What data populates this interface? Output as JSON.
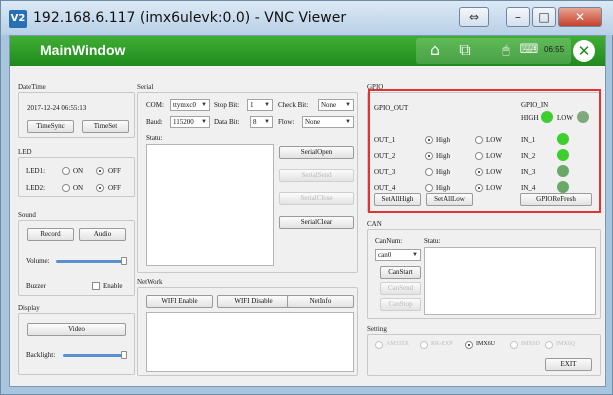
{
  "window": {
    "title": "192.168.6.117 (imx6ulevk:0.0) - VNC Viewer",
    "app_icon": "V2",
    "buttons": {
      "restore": "⇔",
      "minimize": "–",
      "maximize": "□",
      "close": "✕"
    }
  },
  "header": {
    "title": "MainWindow",
    "time": "06:55",
    "icons": [
      "home-icon",
      "window-switch-icon",
      "mouse-icon",
      "keyboard-icon"
    ],
    "close_glyph": "✕",
    "colors": {
      "bar": "#2a9a25",
      "tray": "#6cc064"
    }
  },
  "datetime": {
    "title": "DateTime",
    "value": "2017-12-24 06:55:13",
    "sync_button": "TimeSync",
    "set_button": "TimeSet"
  },
  "led": {
    "title": "LED",
    "led1_label": "LED1:",
    "led2_label": "LED2:",
    "on_label": "ON",
    "off_label": "OFF",
    "led1_state": "OFF",
    "led2_state": "OFF"
  },
  "sound": {
    "title": "Sound",
    "record_button": "Record",
    "audio_button": "Audio",
    "volume_label": "Volume:",
    "volume_level": 1.0,
    "buzzer_label": "Buzzer",
    "enable_label": "Enable",
    "buzzer_enabled": false
  },
  "display": {
    "title": "Display",
    "video_button": "Video",
    "backlight_label": "Backlight:",
    "backlight_level": 1.0
  },
  "serial": {
    "title": "Serial",
    "com_label": "COM:",
    "com_value": "ttymxc0",
    "stopbit_label": "Stop Bit:",
    "stopbit_value": "1",
    "checkbit_label": "Check Bit:",
    "checkbit_value": "None",
    "baud_label": "Baud:",
    "baud_value": "115200",
    "databit_label": "Data Bit:",
    "databit_value": "8",
    "flow_label": "Flow:",
    "flow_value": "None",
    "status_label": "Statu:",
    "open_button": "SerialOpen",
    "send_button": "SerialSend",
    "close_button": "SerialClose",
    "clear_button": "SerialClear"
  },
  "network": {
    "title": "NetWork",
    "wifi_enable_button": "WIFI Enable",
    "wifi_disable_button": "WIFI Disable",
    "netinfo_button": "NetInfo"
  },
  "gpio": {
    "title": "GPIO",
    "out_title": "GPIO_OUT",
    "in_title": "GPIO_IN",
    "high_label": "High",
    "low_label": "LOW",
    "in_high_label": "HIGH",
    "in_low_label": "LOW",
    "outputs": [
      {
        "label": "OUT_1",
        "state": "High"
      },
      {
        "label": "OUT_2",
        "state": "High"
      },
      {
        "label": "OUT_3",
        "state": "LOW"
      },
      {
        "label": "OUT_4",
        "state": "LOW"
      }
    ],
    "inputs": [
      {
        "label": "IN_1",
        "state": "HIGH"
      },
      {
        "label": "IN_2",
        "state": "HIGH"
      },
      {
        "label": "IN_3",
        "state": "LOW"
      },
      {
        "label": "IN_4",
        "state": "LOW"
      }
    ],
    "set_all_high_button": "SetAllHigh",
    "set_all_low_button": "SetAllLow",
    "refresh_button": "GPIOReFresh",
    "colors": {
      "high": "#3ecf2e",
      "low": "#6aa86a",
      "highlight": "#e23232"
    }
  },
  "can": {
    "title": "CAN",
    "cannum_label": "CanNum:",
    "cannum_value": "can0",
    "status_label": "Statu:",
    "start_button": "CanStart",
    "send_button": "CanSend",
    "stop_button": "CanStop"
  },
  "setting": {
    "title": "Setting",
    "options": [
      "AM335X",
      "RK-EXP",
      "IMX6U",
      "IMX6D",
      "IMX6Q"
    ],
    "selected": "IMX6U",
    "exit_button": "EXIT"
  }
}
